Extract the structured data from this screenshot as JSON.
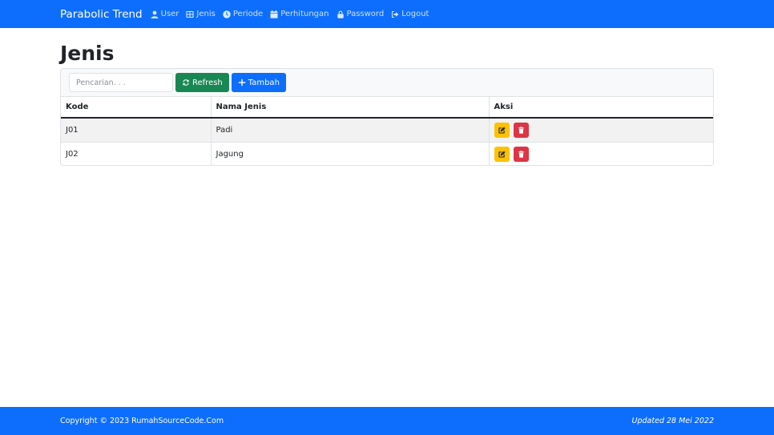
{
  "navbar": {
    "brand": "Parabolic Trend",
    "items": [
      {
        "label": "User",
        "icon": "user-icon"
      },
      {
        "label": "Jenis",
        "icon": "table-icon"
      },
      {
        "label": "Periode",
        "icon": "clock-icon"
      },
      {
        "label": "Perhitungan",
        "icon": "calendar-icon"
      },
      {
        "label": "Password",
        "icon": "lock-icon"
      },
      {
        "label": "Logout",
        "icon": "logout-icon"
      }
    ]
  },
  "page": {
    "title": "Jenis"
  },
  "toolbar": {
    "search_placeholder": "Pencarian. . .",
    "search_value": "",
    "refresh_label": "Refresh",
    "add_label": "Tambah"
  },
  "table": {
    "headers": [
      "Kode",
      "Nama Jenis",
      "Aksi"
    ],
    "rows": [
      {
        "kode": "J01",
        "nama": "Padi"
      },
      {
        "kode": "J02",
        "nama": "Jagung"
      }
    ]
  },
  "footer": {
    "copyright": "Copyright © 2023 RumahSourceCode.Com",
    "updated": "Updated 28 Mei 2022"
  },
  "colors": {
    "primary": "#0d6efd",
    "success": "#198754",
    "warning": "#ffc107",
    "danger": "#dc3545"
  }
}
